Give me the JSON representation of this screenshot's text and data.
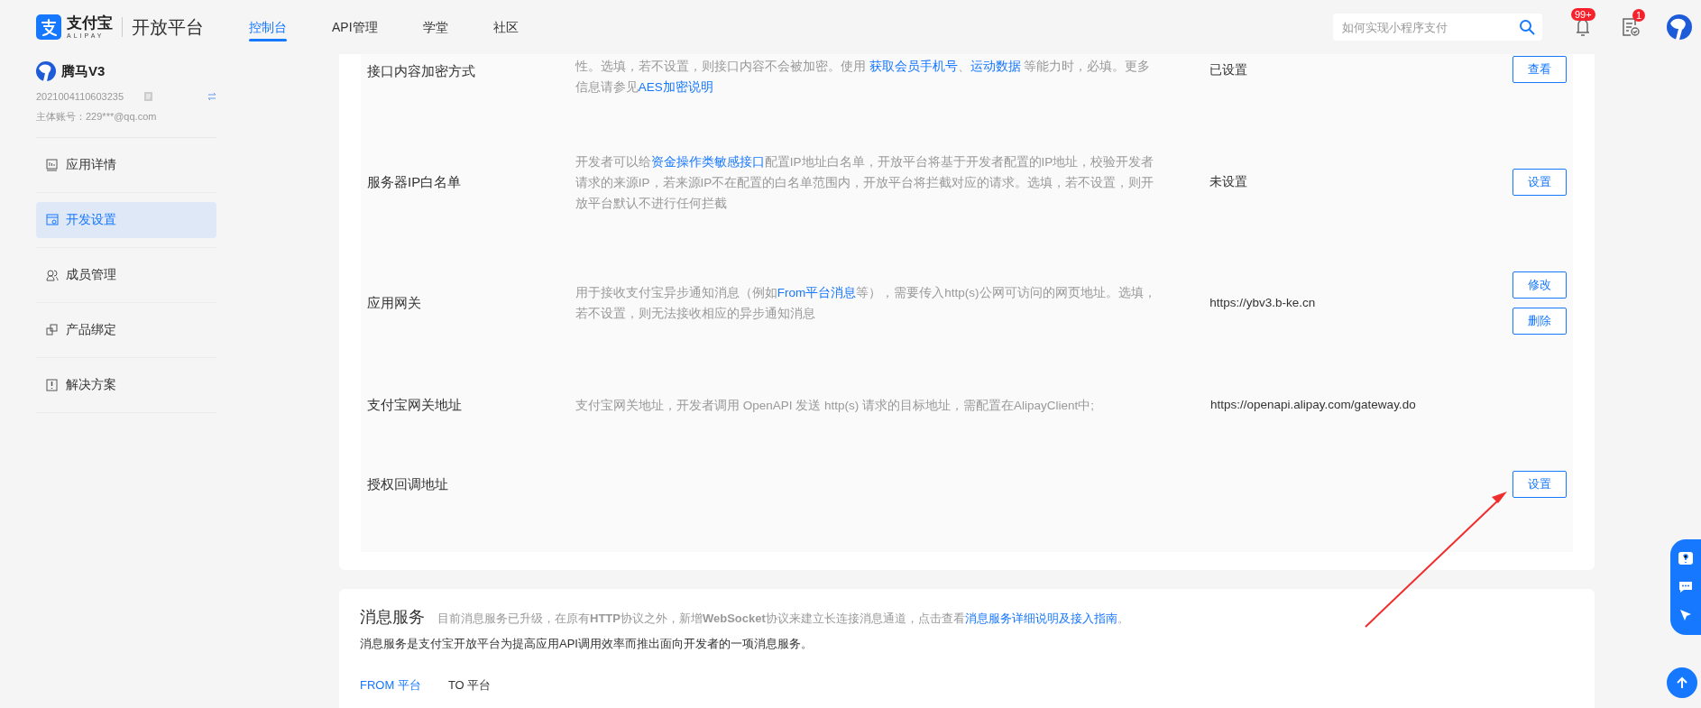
{
  "header": {
    "logo": {
      "brand": "支付宝",
      "sub": "ALIPAY",
      "product": "开放平台"
    },
    "nav": [
      {
        "label": "控制台",
        "selected": true
      },
      {
        "label": "API管理",
        "selected": false
      },
      {
        "label": "学堂",
        "selected": false
      },
      {
        "label": "社区",
        "selected": false
      }
    ],
    "search": {
      "placeholder": "如何实现小程序支付"
    },
    "notifications": {
      "badge": "99+"
    },
    "tasks": {
      "badge": "1"
    }
  },
  "sidebar": {
    "app": {
      "name": "腾马V3",
      "id": "2021004110603235",
      "account": "主体账号：229***@qq.com"
    },
    "items": [
      {
        "label": "应用详情",
        "selected": false
      },
      {
        "label": "开发设置",
        "selected": true
      },
      {
        "label": "成员管理",
        "selected": false
      },
      {
        "label": "产品绑定",
        "selected": false
      },
      {
        "label": "解决方案",
        "selected": false
      }
    ]
  },
  "settings": {
    "rows": [
      {
        "label": "接口内容加密方式",
        "description": [
          {
            "text": "性。选填，若不设置，则接口内容不会被加密。使用 ",
            "link": false
          },
          {
            "text": "获取会员手机号",
            "link": true
          },
          {
            "text": "、",
            "link": false
          },
          {
            "text": "运动数据",
            "link": true
          },
          {
            "text": " 等能力时，必填。更多信息请参见",
            "link": false
          },
          {
            "text": "AES加密说明",
            "link": true
          }
        ],
        "status": "已设置",
        "buttons": [
          "查看"
        ]
      },
      {
        "label": "服务器IP白名单",
        "description": [
          {
            "text": "开发者可以给",
            "link": false
          },
          {
            "text": "资金操作类敏感接口",
            "link": true
          },
          {
            "text": "配置IP地址白名单，开放平台将基于开发者配置的IP地址，校验开发者请求的来源IP，若来源IP不在配置的白名单范围内，开放平台将拦截对应的请求。选填，若不设置，则开放平台默认不进行任何拦截",
            "link": false
          }
        ],
        "status": "未设置",
        "buttons": [
          "设置"
        ]
      },
      {
        "label": "应用网关",
        "description": [
          {
            "text": "用于接收支付宝异步通知消息（例如",
            "link": false
          },
          {
            "text": "From平台消息",
            "link": true
          },
          {
            "text": "等），需要传入http(s)公网可访问的网页地址。选填，若不设置，则无法接收相应的异步通知消息",
            "link": false
          }
        ],
        "status": "https://ybv3.b-ke.cn",
        "buttons": [
          "修改",
          "删除"
        ]
      },
      {
        "label": "支付宝网关地址",
        "description": [
          {
            "text": "支付宝网关地址，开发者调用 OpenAPI 发送 http(s) 请求的目标地址，需配置在AlipayClient中;",
            "link": false
          }
        ],
        "status": "https://openapi.alipay.com/gateway.do",
        "buttons": []
      },
      {
        "label": "授权回调地址",
        "description": [],
        "buttons": [
          "设置"
        ]
      }
    ]
  },
  "messages": {
    "title": "消息服务",
    "notice": [
      {
        "text": "目前消息服务已升级，在原有**HTTP**协议之外，新增**WebSocket**协议来建立长连接消息通道，点击查看",
        "link": false
      },
      {
        "text": "消息服务详细说明及接入指南",
        "link": true
      },
      {
        "text": "。",
        "link": false
      }
    ],
    "intro": "消息服务是支付宝开放平台为提高应用API调用效率而推出面向开发者的一项消息服务。",
    "tabs": [
      {
        "label": "FROM 平台",
        "selected": true
      },
      {
        "label": "TO 平台",
        "selected": false
      }
    ]
  }
}
